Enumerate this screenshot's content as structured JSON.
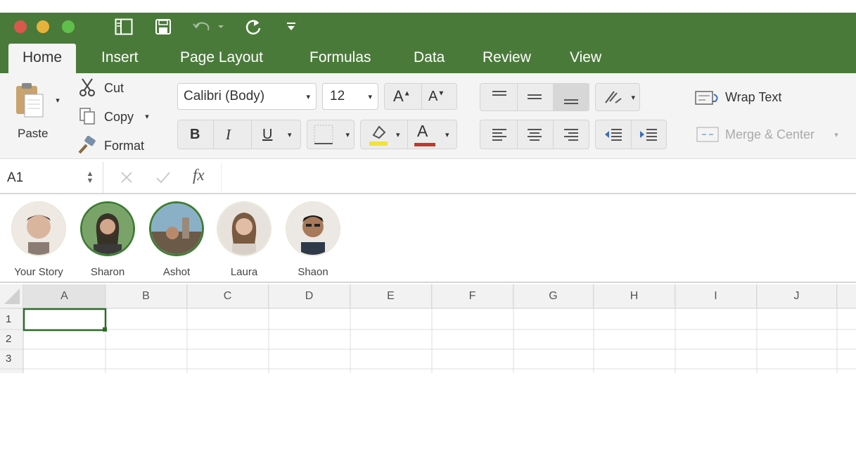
{
  "window": {
    "title_bar_color": "#4a7a3a",
    "quick_access": [
      "sidebar-icon",
      "save-icon",
      "undo-icon",
      "redo-icon",
      "customize-icon"
    ]
  },
  "tabs": [
    {
      "label": "Home",
      "active": true
    },
    {
      "label": "Insert",
      "active": false
    },
    {
      "label": "Page Layout",
      "active": false
    },
    {
      "label": "Formulas",
      "active": false
    },
    {
      "label": "Data",
      "active": false
    },
    {
      "label": "Review",
      "active": false
    },
    {
      "label": "View",
      "active": false
    }
  ],
  "ribbon": {
    "clipboard": {
      "paste_label": "Paste",
      "cut_label": "Cut",
      "copy_label": "Copy",
      "format_label": "Format"
    },
    "font": {
      "font_name": "Calibri (Body)",
      "font_size": "12",
      "bold": "B",
      "italic": "I",
      "underline": "U",
      "font_color_letter": "A"
    },
    "alignment": {
      "wrap_text_label": "Wrap Text",
      "merge_center_label": "Merge & Center"
    }
  },
  "formula_bar": {
    "name_box": "A1",
    "fx_label": "fx",
    "formula": ""
  },
  "stories": [
    {
      "name": "Your Story",
      "ring": false
    },
    {
      "name": "Sharon",
      "ring": true
    },
    {
      "name": "Ashot",
      "ring": true
    },
    {
      "name": "Laura",
      "ring": false
    },
    {
      "name": "Shaon",
      "ring": false
    }
  ],
  "sheet": {
    "columns": [
      "A",
      "B",
      "C",
      "D",
      "E",
      "F",
      "G",
      "H",
      "I",
      "J"
    ],
    "rows": [
      "1",
      "2",
      "3"
    ],
    "selected_cell": "A1"
  },
  "colors": {
    "accent_green": "#4a7a3a",
    "fill_yellow": "#f2e23a",
    "font_red": "#c0392b"
  }
}
